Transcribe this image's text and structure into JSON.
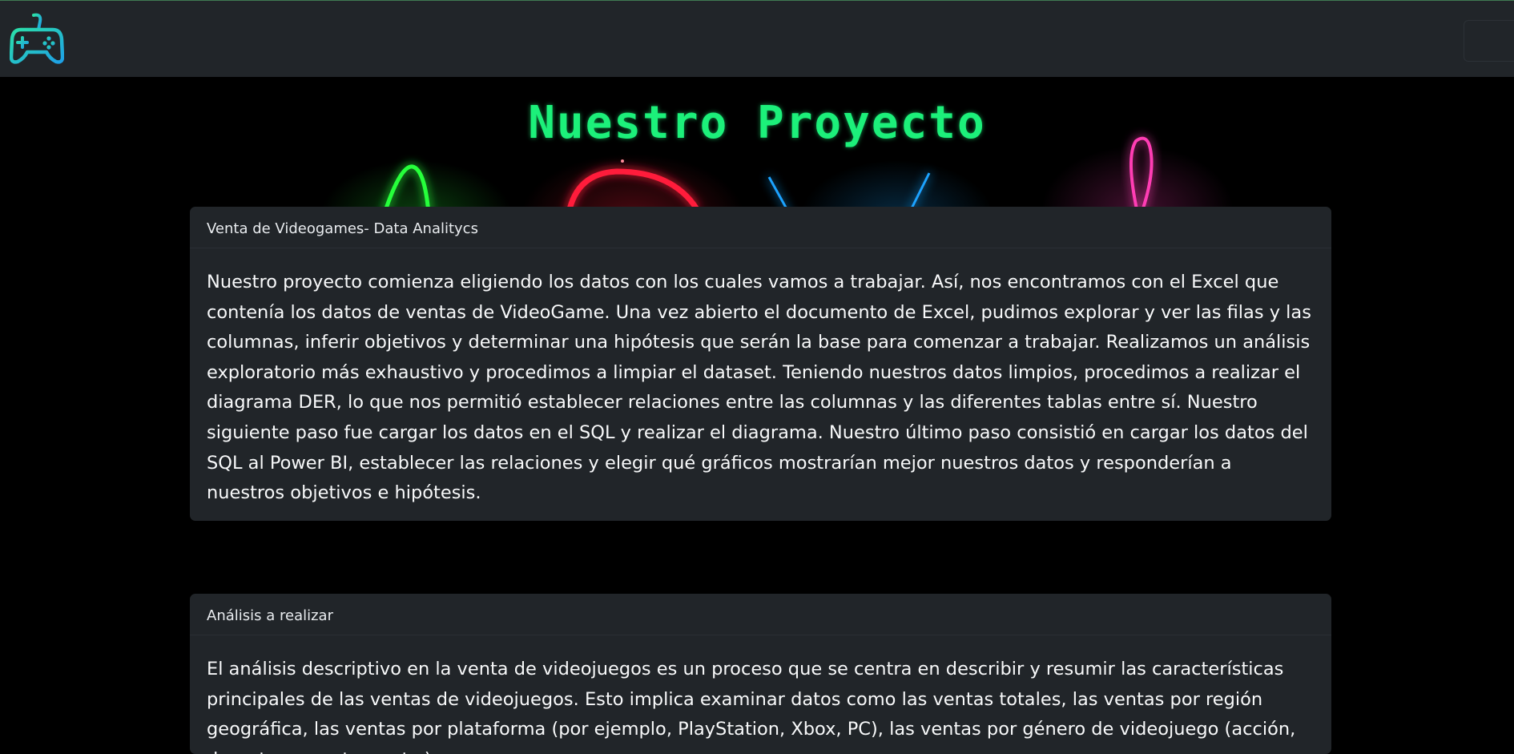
{
  "navbar": {
    "logo_icon": "gamepad-icon",
    "logo_color": "#22c1c3",
    "toggler_icon": "menu-icon"
  },
  "hero": {
    "title": "Nuestro Proyecto",
    "title_color": "#1cf07a",
    "neon_colors": [
      "#27ff3a",
      "#ff1f3a",
      "#1aa3ff",
      "#ff3cb4"
    ]
  },
  "cards": [
    {
      "header": "Venta de Videogames- Data Analitycs",
      "body": "Nuestro proyecto comienza eligiendo los datos con los cuales vamos a trabajar. Así, nos encontramos con el Excel que contenía los datos de ventas de VideoGame. Una vez abierto el documento de Excel, pudimos explorar y ver las filas y las columnas, inferir objetivos y determinar una hipótesis que serán la base para comenzar a trabajar. Realizamos un análisis exploratorio más exhaustivo y procedimos a limpiar el dataset. Teniendo nuestros datos limpios, procedimos a realizar el diagrama DER, lo que nos permitió establecer relaciones entre las columnas y las diferentes tablas entre sí. Nuestro siguiente paso fue cargar los datos en el SQL y realizar el diagrama. Nuestro último paso consistió en cargar los datos del SQL al Power BI, establecer las relaciones y elegir qué gráficos mostrarían mejor nuestros datos y responderían a nuestros objetivos e hipótesis."
    },
    {
      "header": "Análisis a realizar",
      "body": "El análisis descriptivo en la venta de videojuegos es un proceso que se centra en describir y resumir las características principales de las ventas de videojuegos. Esto implica examinar datos como las ventas totales, las ventas por región geográfica, las ventas por plataforma (por ejemplo, PlayStation, Xbox, PC), las ventas por género de videojuego (acción, deportes, aventura, etc.)"
    }
  ]
}
